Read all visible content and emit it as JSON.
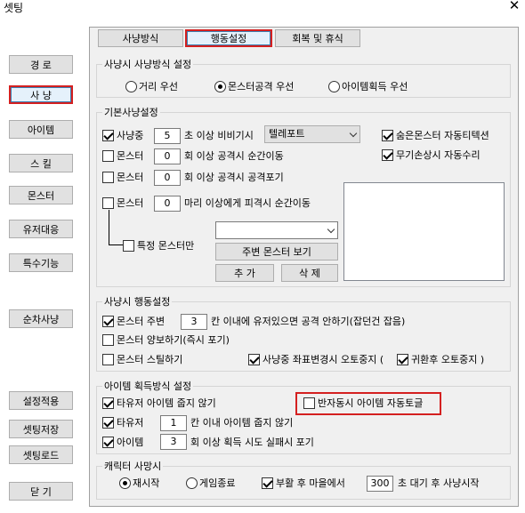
{
  "window": {
    "title": "셋팅",
    "close_icon": "✕"
  },
  "sidebar": {
    "items": [
      {
        "label": "경  로"
      },
      {
        "label": "사  냥"
      },
      {
        "label": "아이템"
      },
      {
        "label": "스  킬"
      },
      {
        "label": "몬스터"
      },
      {
        "label": "유저대응"
      },
      {
        "label": "특수기능"
      },
      {
        "label": "순차사냥"
      },
      {
        "label": "설정적용"
      },
      {
        "label": "셋팅저장"
      },
      {
        "label": "셋팅로드"
      },
      {
        "label": "닫  기"
      }
    ],
    "active_index": 1
  },
  "tabs": [
    {
      "label": "사냥방식"
    },
    {
      "label": "행동설정"
    },
    {
      "label": "회복 및 휴식"
    }
  ],
  "hunt_method": {
    "legend": "사냥시 사냥방식 설정",
    "options": [
      {
        "label": "거리 우선",
        "checked": false
      },
      {
        "label": "몬스터공격 우선",
        "checked": true
      },
      {
        "label": "아이템획득 우선",
        "checked": false
      }
    ]
  },
  "basic": {
    "legend": "기본사냥설정",
    "row1": {
      "chk": "사냥중",
      "value": "5",
      "suffix": "초 이상 비비기시",
      "combo": "텔레포트"
    },
    "row2": {
      "chk": "몬스터",
      "value": "0",
      "suffix": "회 이상 공격시 순간이동"
    },
    "row3": {
      "chk": "몬스터",
      "value": "0",
      "suffix": "회 이상 공격시 공격포기"
    },
    "row4": {
      "chk": "몬스터",
      "value": "0",
      "suffix": "마리 이상에게 피격시 순간이동"
    },
    "specific": "특정 몬스터만",
    "right1": "숨은몬스터 자동티텍션",
    "right2": "무기손상시 자동수리",
    "monster_combo": "",
    "view_button": "주변 몬스터 보기",
    "add_button": "추  가",
    "delete_button": "삭  제"
  },
  "action": {
    "legend": "사냥시 행동설정",
    "row1": {
      "chk": "몬스터 주변",
      "value": "3",
      "suffix": "칸 이내에 유저있으면 공격 안하기(잡던건 잡음)"
    },
    "row2": "몬스터 양보하기(즉시 포기)",
    "row3": "몬스터 스틸하기",
    "row3b": "사냥중 좌표변경시 오토중지 (",
    "row3c": "귀환후 오토중지  )"
  },
  "item": {
    "legend": "아이템 획득방식 설정",
    "row1": "타유저 아이템 줍지 않기",
    "row1r": "반자동시 아이템 자동토글",
    "row2": {
      "chk": "타유저",
      "value": "1",
      "suffix": "칸 이내 아이템 줍지 않기"
    },
    "row3": {
      "chk": "아이템",
      "value": "3",
      "suffix": "회 이상 획득 시도 실패시 포기"
    }
  },
  "death": {
    "legend": "캐릭터 사망시",
    "opt1": "재시작",
    "opt2": "게임종료",
    "revive": "부활 후 마을에서",
    "value": "300",
    "suffix": "초 대기 후 사냥시작"
  },
  "colors": {
    "highlight": "#d42020",
    "panel": "#f0f0f0"
  }
}
